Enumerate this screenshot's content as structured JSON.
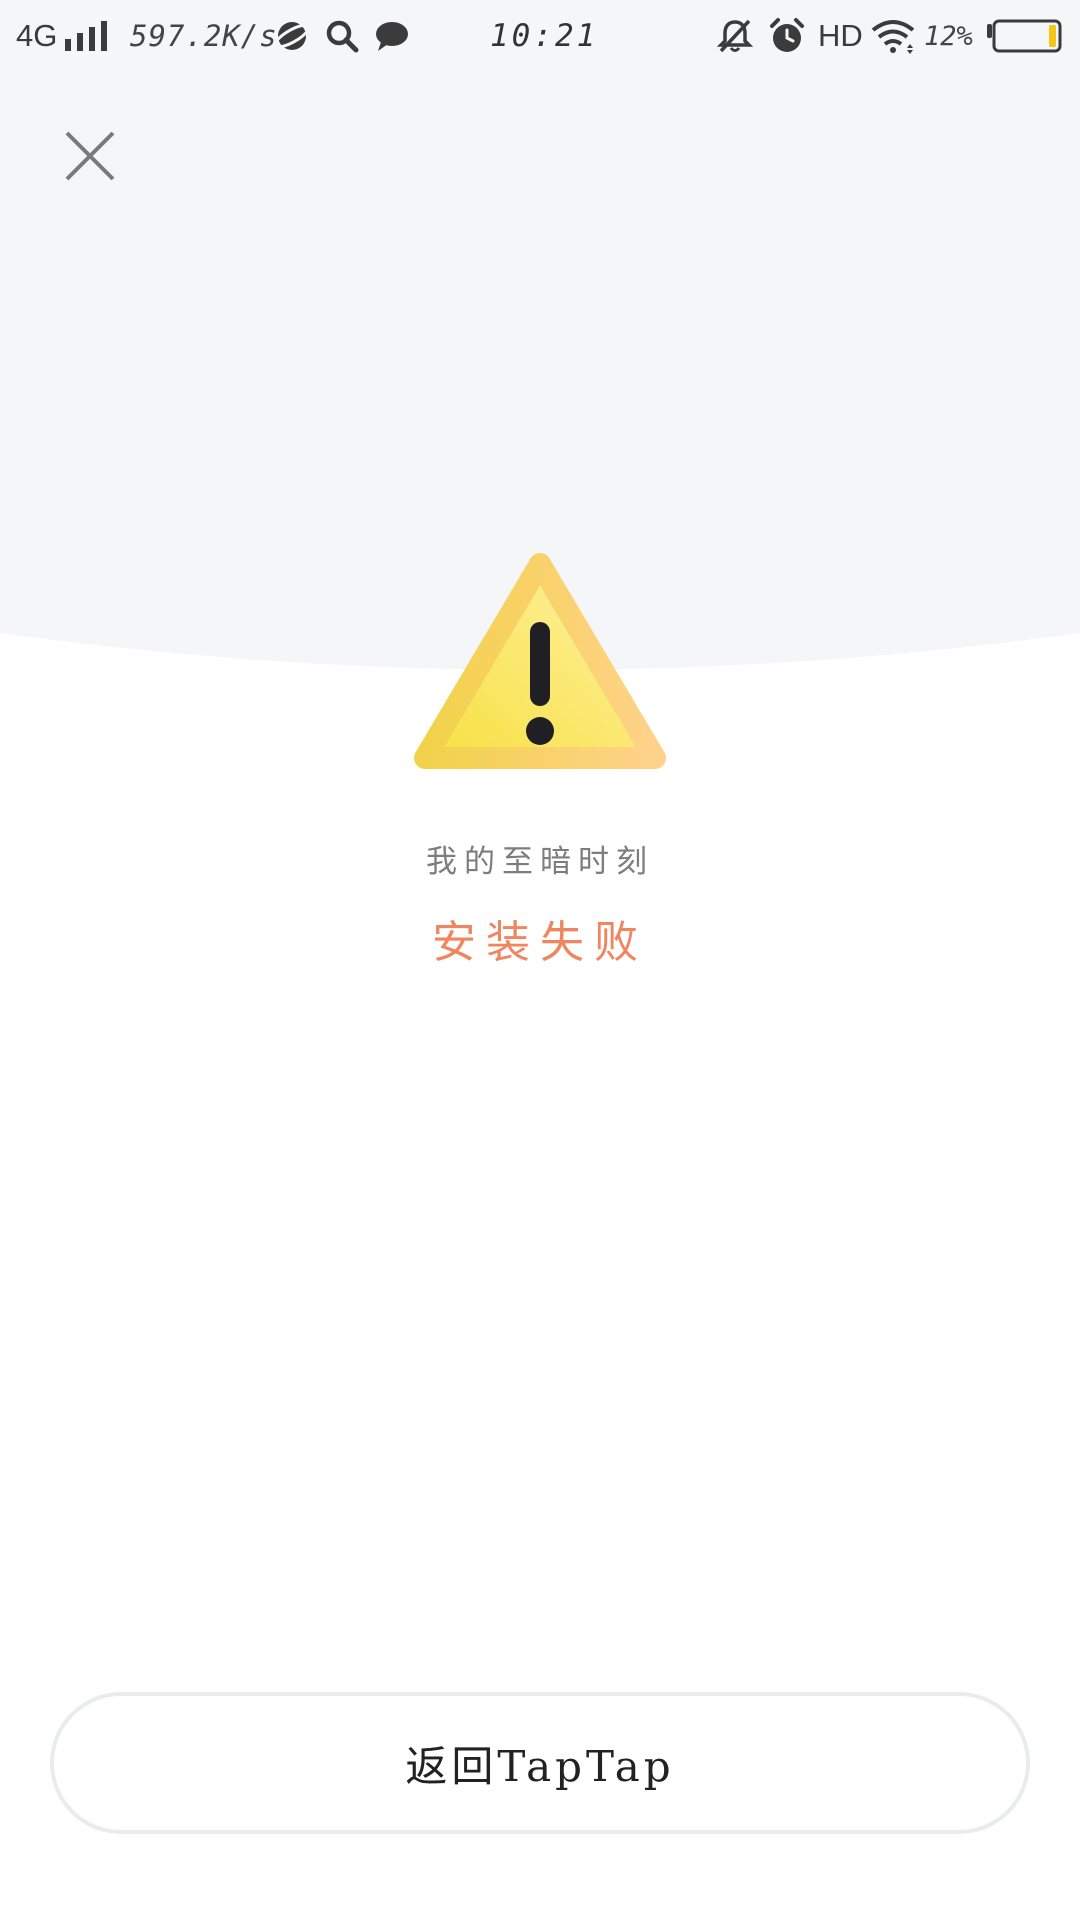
{
  "status_bar": {
    "network": "4G",
    "speed": "597.2K/s",
    "time": "10:21",
    "hd": "HD",
    "battery": "12%",
    "icons": [
      "signal-icon",
      "browser-icon",
      "search-icon",
      "chat-icon",
      "mute-bell-icon",
      "alarm-icon",
      "wifi-icon",
      "battery-icon"
    ]
  },
  "header": {
    "close_icon": "close-icon"
  },
  "result": {
    "icon": "warning-icon",
    "app_name": "我的至暗时刻",
    "status": "安装失败"
  },
  "footer": {
    "return_label": "返回TapTap"
  },
  "colors": {
    "top_background": "#f5f6f8",
    "status_accent": "#f0865f",
    "warning_yellow": "#f7e040",
    "warning_orange": "#ffd28a",
    "battery_level": "#f5c518"
  }
}
